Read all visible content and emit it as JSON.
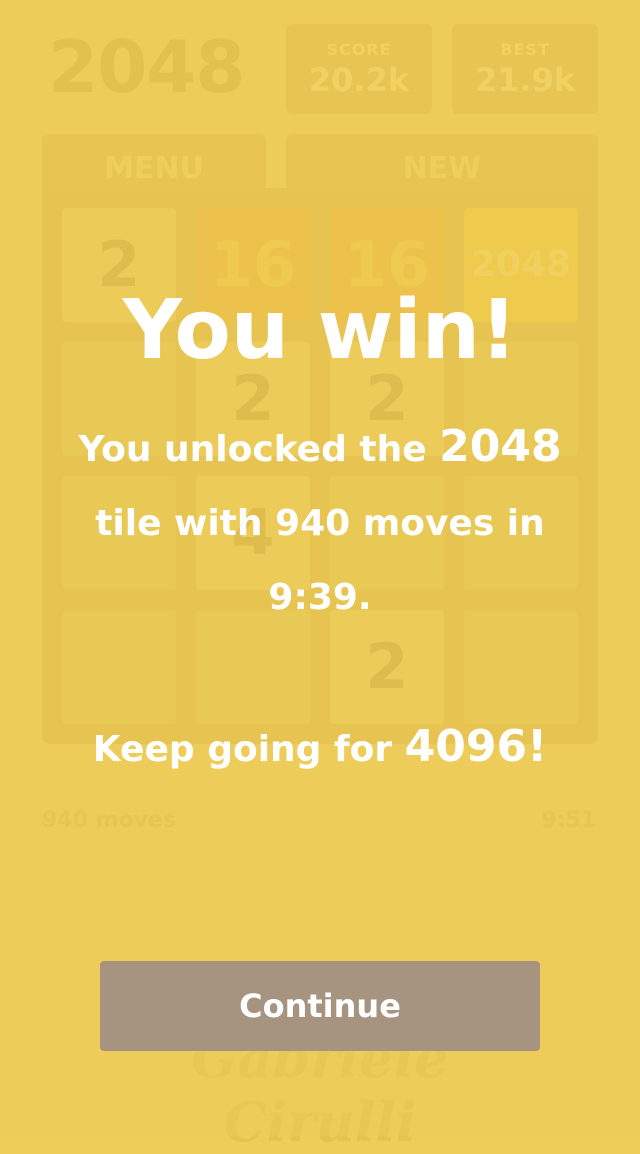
{
  "header": {
    "title": "2048",
    "score": {
      "label": "SCORE",
      "value": "20.2k"
    },
    "best": {
      "label": "BEST",
      "value": "21.9k"
    }
  },
  "buttons": {
    "menu": "MENU",
    "new": "NEW"
  },
  "board": {
    "cells": [
      [
        "2",
        "16",
        "16",
        "2048"
      ],
      [
        "",
        "2",
        "2",
        ""
      ],
      [
        "",
        "4",
        "",
        ""
      ],
      [
        "",
        "",
        "2",
        ""
      ]
    ]
  },
  "footer": {
    "moves": "940 moves",
    "time": "9:51"
  },
  "signature": "Gabriele Cirulli",
  "dialog": {
    "title": "You win!",
    "msg_part1": "You unlocked the ",
    "msg_highlight": "2048",
    "msg_part2": " tile with 940 moves in 9:39.",
    "keep_prefix": "Keep going for ",
    "keep_highlight": "4096",
    "keep_suffix": "!",
    "continue_label": "Continue"
  },
  "colors": {
    "background": "#eecd59",
    "overlay_text": "#ffffff",
    "continue_button": "#a69481"
  }
}
